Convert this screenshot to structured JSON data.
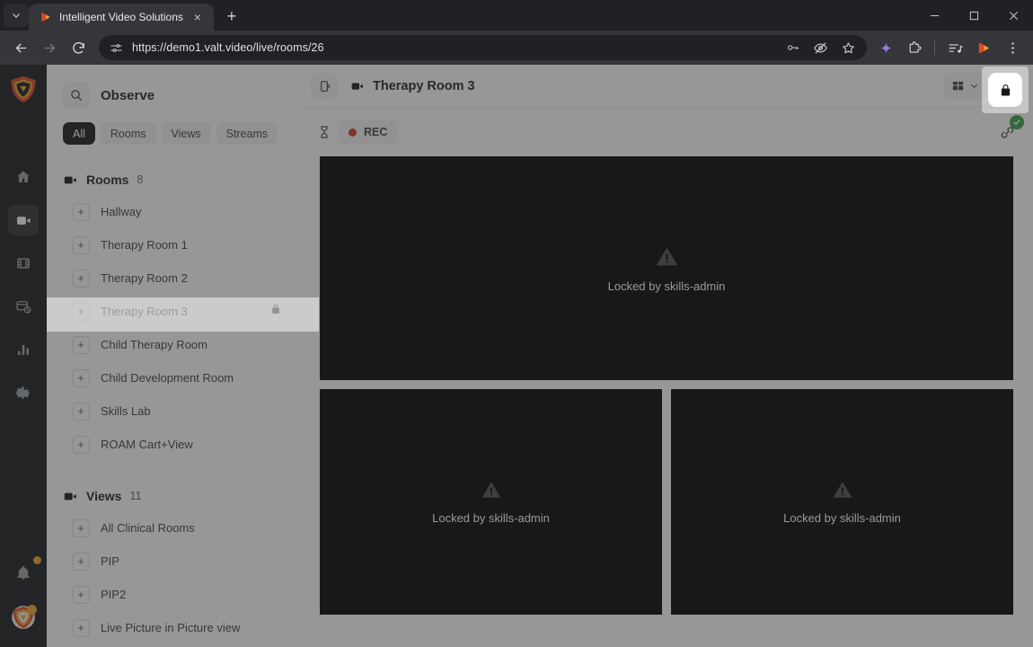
{
  "browser": {
    "tab": {
      "title": "Intelligent Video Solutions",
      "favicon": "ivs-play-icon",
      "close": "×"
    },
    "new_tab_label": "+",
    "window_controls": {
      "minimize": "—",
      "maximize": "□",
      "close": "✕"
    },
    "nav": {
      "back": "←",
      "forward": "→",
      "reload": "↻"
    },
    "omnibox": {
      "url": "https://demo1.valt.video/live/rooms/26",
      "site_icon": "site-settings-icon",
      "actions": [
        "password-key-icon",
        "eye-slash-icon",
        "bookmark-star-icon"
      ]
    },
    "toolbar_icons": [
      "gemini-icon",
      "extensions-puzzle-icon",
      "media-list-icon",
      "ivs-play-icon",
      "chrome-menu-icon"
    ]
  },
  "rail": {
    "logo": "ivs-shield-logo",
    "items": [
      {
        "name": "home",
        "icon": "home-icon",
        "active": false
      },
      {
        "name": "live",
        "icon": "video-camera-icon",
        "active": true
      },
      {
        "name": "recordings",
        "icon": "film-strip-icon",
        "active": false
      },
      {
        "name": "scheduling",
        "icon": "card-clock-icon",
        "active": false
      },
      {
        "name": "reports",
        "icon": "bar-chart-icon",
        "active": false
      },
      {
        "name": "settings",
        "icon": "gear-icon",
        "active": false
      }
    ],
    "notifications": {
      "icon": "bell-icon",
      "has_badge": true
    },
    "account": {
      "icon": "user-avatar",
      "has_badge": true
    }
  },
  "sidepanel": {
    "title": "Observe",
    "search_icon": "search-icon",
    "filters": [
      {
        "label": "All",
        "active": true
      },
      {
        "label": "Rooms",
        "active": false
      },
      {
        "label": "Views",
        "active": false
      },
      {
        "label": "Streams",
        "active": false
      }
    ],
    "groups": [
      {
        "name": "Rooms",
        "count": "8",
        "icon": "video-camera-icon",
        "items": [
          {
            "label": "Hallway",
            "locked": false,
            "selected": false
          },
          {
            "label": "Therapy Room 1",
            "locked": false,
            "selected": false
          },
          {
            "label": "Therapy Room 2",
            "locked": false,
            "selected": false
          },
          {
            "label": "Therapy Room 3",
            "locked": true,
            "selected": true
          },
          {
            "label": "Child Therapy Room",
            "locked": false,
            "selected": false
          },
          {
            "label": "Child Development Room",
            "locked": false,
            "selected": false
          },
          {
            "label": "Skills Lab",
            "locked": false,
            "selected": false
          },
          {
            "label": "ROAM Cart+View",
            "locked": false,
            "selected": false
          }
        ]
      },
      {
        "name": "Views",
        "count": "11",
        "icon": "video-camera-icon",
        "items": [
          {
            "label": "All Clinical Rooms",
            "locked": false,
            "selected": false
          },
          {
            "label": "PIP",
            "locked": false,
            "selected": false
          },
          {
            "label": "PIP2",
            "locked": false,
            "selected": false
          },
          {
            "label": "Live Picture in Picture view",
            "locked": false,
            "selected": false
          }
        ]
      }
    ],
    "expand_glyph": "+"
  },
  "main": {
    "collapse_icon": "collapse-panel-icon",
    "room_icon": "video-camera-icon",
    "room_name": "Therapy Room 3",
    "layout_button": {
      "icon": "layout-grid-icon",
      "chevron": "chevron-down-icon"
    },
    "fullscreen_icon": "fullscreen-expand-icon",
    "toolbar": {
      "timer_icon": "hourglass-icon",
      "rec_label": "REC",
      "rec_color": "#cf3c1e",
      "share_link": {
        "icon": "link-chain-icon",
        "badge": "check-icon",
        "badge_color": "#34a147"
      },
      "lock": {
        "icon": "padlock-closed-icon",
        "active": true
      }
    },
    "tiles": [
      {
        "position": "top",
        "message": "Locked by skills-admin",
        "icon": "warning-triangle-icon"
      },
      {
        "position": "bottom-left",
        "message": "Locked by skills-admin",
        "icon": "warning-triangle-icon"
      },
      {
        "position": "bottom-right",
        "message": "Locked by skills-admin",
        "icon": "warning-triangle-icon"
      }
    ]
  },
  "colors": {
    "rail_bg": "#17181a",
    "accent_orange": "#e8a33d",
    "rec_red": "#cf3c1e",
    "check_green": "#34a147",
    "tile_bg": "#000000"
  }
}
